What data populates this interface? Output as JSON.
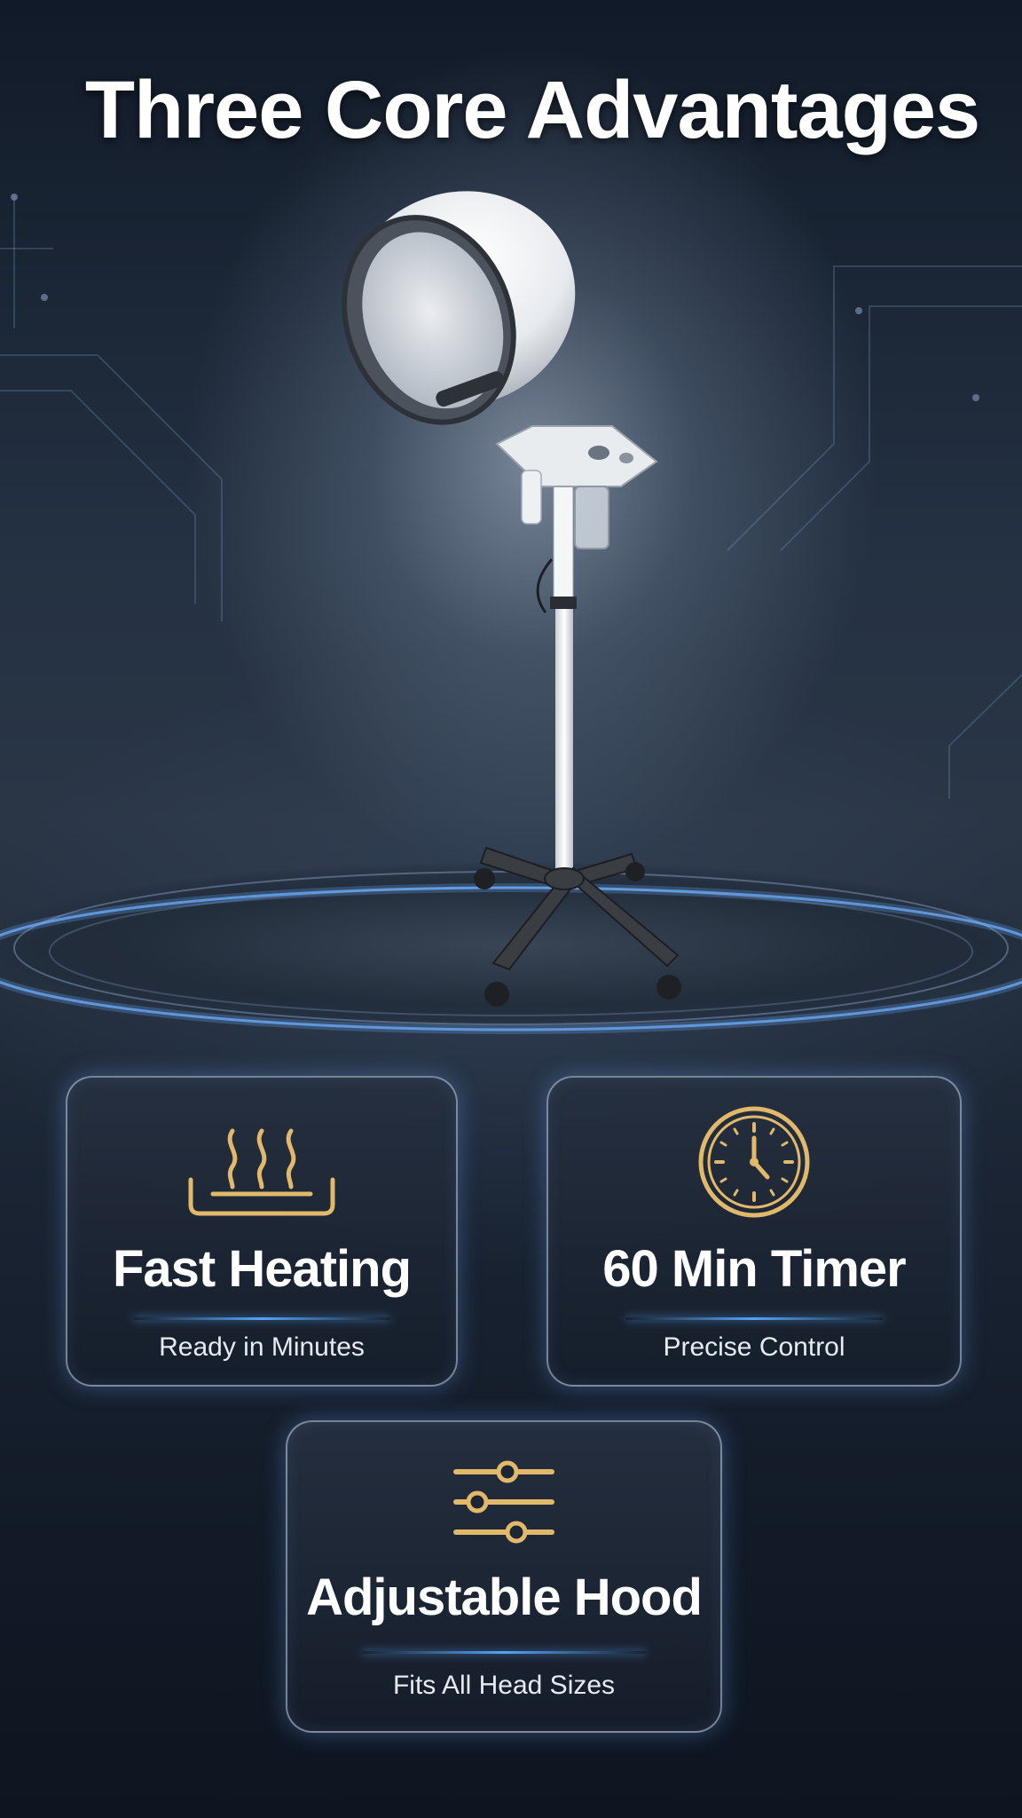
{
  "title": "Three Core Advantages",
  "accent_gold": "#e2b96a",
  "accent_glow": "#5aaaff",
  "product": {
    "name_icon": "hooded-hair-steamer-on-stand"
  },
  "features": [
    {
      "icon": "heat-waves-icon",
      "title": "Fast Heating",
      "subtitle": "Ready in Minutes"
    },
    {
      "icon": "clock-icon",
      "title": "60 Min Timer",
      "subtitle": "Precise Control"
    },
    {
      "icon": "sliders-icon",
      "title": "Adjustable Hood",
      "subtitle": "Fits All Head Sizes"
    }
  ]
}
